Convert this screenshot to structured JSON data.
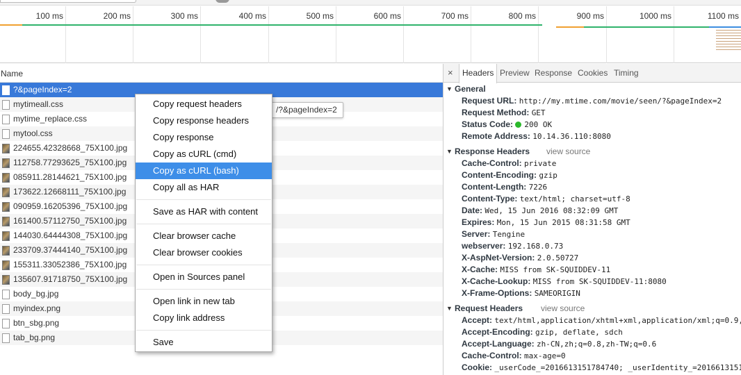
{
  "timeline": {
    "ticks": [
      "100 ms",
      "200 ms",
      "300 ms",
      "400 ms",
      "500 ms",
      "600 ms",
      "700 ms",
      "800 ms",
      "900 ms",
      "1000 ms",
      "1100 ms"
    ]
  },
  "request_list": {
    "header": "Name",
    "items": [
      {
        "name": "?&pageIndex=2",
        "type": "doc"
      },
      {
        "name": "mytimeall.css",
        "type": "doc"
      },
      {
        "name": "mytime_replace.css",
        "type": "doc"
      },
      {
        "name": "mytool.css",
        "type": "doc"
      },
      {
        "name": "224655.42328668_75X100.jpg",
        "type": "img"
      },
      {
        "name": "112758.77293625_75X100.jpg",
        "type": "img"
      },
      {
        "name": "085911.28144621_75X100.jpg",
        "type": "img"
      },
      {
        "name": "173622.12668111_75X100.jpg",
        "type": "img"
      },
      {
        "name": "090959.16205396_75X100.jpg",
        "type": "img"
      },
      {
        "name": "161400.57112750_75X100.jpg",
        "type": "img"
      },
      {
        "name": "144030.64444308_75X100.jpg",
        "type": "img"
      },
      {
        "name": "233709.37444140_75X100.jpg",
        "type": "img"
      },
      {
        "name": "155311.33052386_75X100.jpg",
        "type": "img"
      },
      {
        "name": "135607.91718750_75X100.jpg",
        "type": "img"
      },
      {
        "name": "body_bg.jpg",
        "type": "doc"
      },
      {
        "name": "myindex.png",
        "type": "doc"
      },
      {
        "name": "btn_sbg.png",
        "type": "doc"
      },
      {
        "name": "tab_bg.png",
        "type": "doc"
      }
    ]
  },
  "tooltip": "/?&pageIndex=2",
  "context_menu": {
    "groups": [
      [
        "Copy request headers",
        "Copy response headers",
        "Copy response",
        "Copy as cURL (cmd)",
        "Copy as cURL (bash)",
        "Copy all as HAR"
      ],
      [
        "Save as HAR with content"
      ],
      [
        "Clear browser cache",
        "Clear browser cookies"
      ],
      [
        "Open in Sources panel"
      ],
      [
        "Open link in new tab",
        "Copy link address"
      ],
      [
        "Save"
      ]
    ],
    "highlighted": "Copy as cURL (bash)"
  },
  "details": {
    "close": "×",
    "tabs": [
      "Headers",
      "Preview",
      "Response",
      "Cookies",
      "Timing"
    ],
    "active_tab": "Headers",
    "general": {
      "title": "General",
      "request_url_label": "Request URL:",
      "request_url": "http://my.mtime.com/movie/seen/?&pageIndex=2",
      "request_method_label": "Request Method:",
      "request_method": "GET",
      "status_code_label": "Status Code:",
      "status_code": "200 OK",
      "status_color": "#2bb82b",
      "remote_address_label": "Remote Address:",
      "remote_address": "10.14.36.110:8080"
    },
    "response_headers": {
      "title": "Response Headers",
      "view_source": "view source",
      "items": [
        {
          "k": "Cache-Control:",
          "v": "private"
        },
        {
          "k": "Content-Encoding:",
          "v": "gzip"
        },
        {
          "k": "Content-Length:",
          "v": "7226"
        },
        {
          "k": "Content-Type:",
          "v": "text/html; charset=utf-8"
        },
        {
          "k": "Date:",
          "v": "Wed, 15 Jun 2016 08:32:09 GMT"
        },
        {
          "k": "Expires:",
          "v": "Mon, 15 Jun 2015 08:31:58 GMT"
        },
        {
          "k": "Server:",
          "v": "Tengine"
        },
        {
          "k": "webserver:",
          "v": "192.168.0.73"
        },
        {
          "k": "X-AspNet-Version:",
          "v": "2.0.50727"
        },
        {
          "k": "X-Cache:",
          "v": "MISS from SK-SQUIDDEV-11"
        },
        {
          "k": "X-Cache-Lookup:",
          "v": "MISS from SK-SQUIDDEV-11:8080"
        },
        {
          "k": "X-Frame-Options:",
          "v": "SAMEORIGIN"
        }
      ]
    },
    "request_headers": {
      "title": "Request Headers",
      "view_source": "view source",
      "items": [
        {
          "k": "Accept:",
          "v": "text/html,application/xhtml+xml,application/xml;q=0.9,"
        },
        {
          "k": "Accept-Encoding:",
          "v": "gzip, deflate, sdch"
        },
        {
          "k": "Accept-Language:",
          "v": "zh-CN,zh;q=0.8,zh-TW;q=0.6"
        },
        {
          "k": "Cache-Control:",
          "v": "max-age=0"
        },
        {
          "k": "Cookie:",
          "v": "_userCode_=2016613151784740; _userIdentity_=2016613151"
        }
      ]
    }
  }
}
